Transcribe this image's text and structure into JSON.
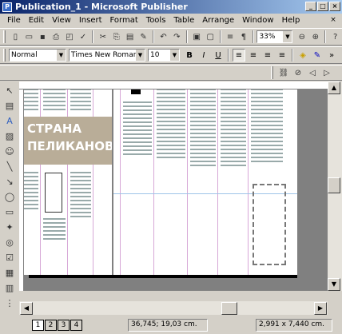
{
  "window": {
    "title": "Publication_1 - Microsoft Publisher",
    "icon": "publisher-icon"
  },
  "menu": [
    "File",
    "Edit",
    "View",
    "Insert",
    "Format",
    "Tools",
    "Table",
    "Arrange",
    "Window",
    "Help"
  ],
  "standard_toolbar": {
    "zoom": "33%"
  },
  "formatting_toolbar": {
    "style": "Normal",
    "font": "Times New Roman",
    "size": "10"
  },
  "banner": {
    "line1": "СТРАНА",
    "line2": "ПЕЛИКАНОВ"
  },
  "status": {
    "pages": [
      "1",
      "2",
      "3",
      "4"
    ],
    "position": "36,745; 19,03 cm.",
    "size": "2,991 x 7,440 cm."
  },
  "colors": {
    "titlebar_start": "#0a246a",
    "titlebar_end": "#a6caf0",
    "chrome": "#d4d0c8",
    "canvas": "#808080"
  }
}
